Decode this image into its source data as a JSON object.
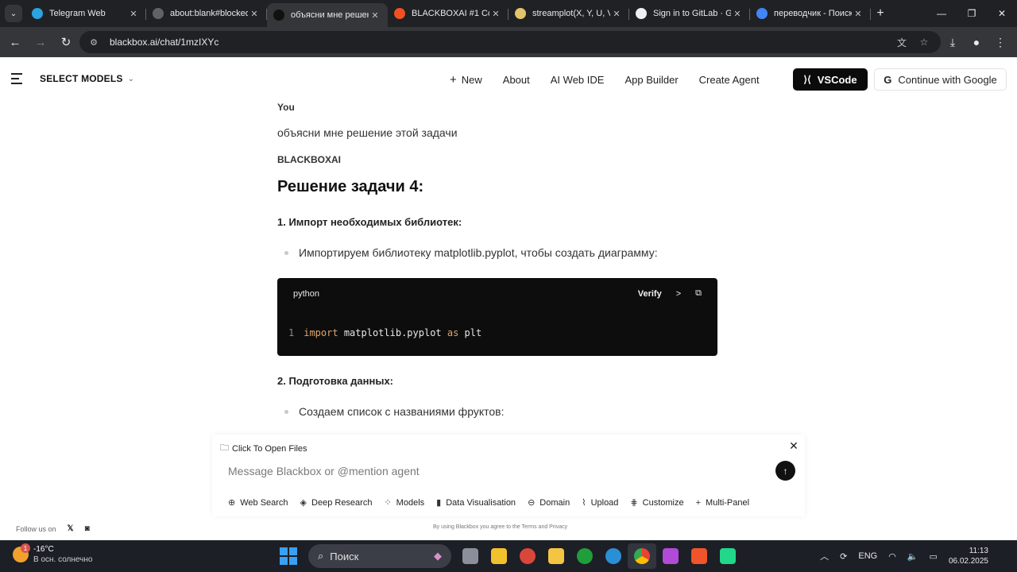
{
  "browser": {
    "tabs": [
      {
        "title": "Telegram Web",
        "favicon": "telegram-icon",
        "color": "#2aa3e0",
        "active": false
      },
      {
        "title": "about:blank#blocked",
        "favicon": "globe-icon",
        "color": "#5f6368",
        "active": false
      },
      {
        "title": "объясни мне решен",
        "favicon": "blackbox-icon",
        "color": "#111111",
        "active": true
      },
      {
        "title": "BLACKBOXAI #1 Cod",
        "favicon": "microsoft-icon",
        "color": "#f25022",
        "active": false
      },
      {
        "title": "streamplot(X, Y, U, V",
        "favicon": "matplotlib-icon",
        "color": "#e3c36b",
        "active": false
      },
      {
        "title": "Sign in to GitLab · G",
        "favicon": "github-icon",
        "color": "#f0f0f0",
        "active": false
      },
      {
        "title": "переводчик - Поиск",
        "favicon": "google-icon",
        "color": "#4285f4",
        "active": false
      }
    ],
    "url": "blackbox.ai/chat/1mzIXYc"
  },
  "header": {
    "select_models": "SELECT MODELS",
    "nav": [
      "New",
      "About",
      "AI Web IDE",
      "App Builder",
      "Create Agent"
    ],
    "vscode_label": "VSCode",
    "google_label": "Continue with Google"
  },
  "chat": {
    "user_role": "You",
    "user_message": "объясни мне решение этой задачи",
    "ai_role": "BLACKBOXAI",
    "heading": "Решение задачи 4:",
    "step1_title": "1. Импорт необходимых библиотек:",
    "step1_bullet": "Импортируем библиотеку matplotlib.pyplot, чтобы создать диаграмму:",
    "code": {
      "lang": "python",
      "verify_label": "Verify",
      "line_number": "1",
      "kw_import": "import",
      "module": " matplotlib.pyplot ",
      "kw_as": "as",
      "alias": " plt"
    },
    "step2_title": "2. Подготовка данных:",
    "step2_bullet": "Создаем список с названиями фруктов:"
  },
  "composer": {
    "files_label": "Click To Open Files",
    "placeholder": "Message Blackbox or @mention agent",
    "tools": [
      {
        "label": "Web Search",
        "icon": "globe-icon"
      },
      {
        "label": "Deep Research",
        "icon": "layers-icon"
      },
      {
        "label": "Models",
        "icon": "grid-icon"
      },
      {
        "label": "Data Visualisation",
        "icon": "bar-chart-icon"
      },
      {
        "label": "Domain",
        "icon": "link-icon"
      },
      {
        "label": "Upload",
        "icon": "paperclip-icon"
      },
      {
        "label": "Customize",
        "icon": "sliders-icon"
      },
      {
        "label": "Multi-Panel",
        "icon": "plus-icon"
      }
    ]
  },
  "footer": {
    "follow": "Follow us on",
    "disclaimer": "By using Blackbox you agree to the Terms and Privacy"
  },
  "taskbar": {
    "temp": "-16°C",
    "weather": "В осн. солнечно",
    "weather_badge": "1",
    "search": "Поиск",
    "lang": "ENG",
    "time": "11:13",
    "date": "06.02.2025"
  }
}
